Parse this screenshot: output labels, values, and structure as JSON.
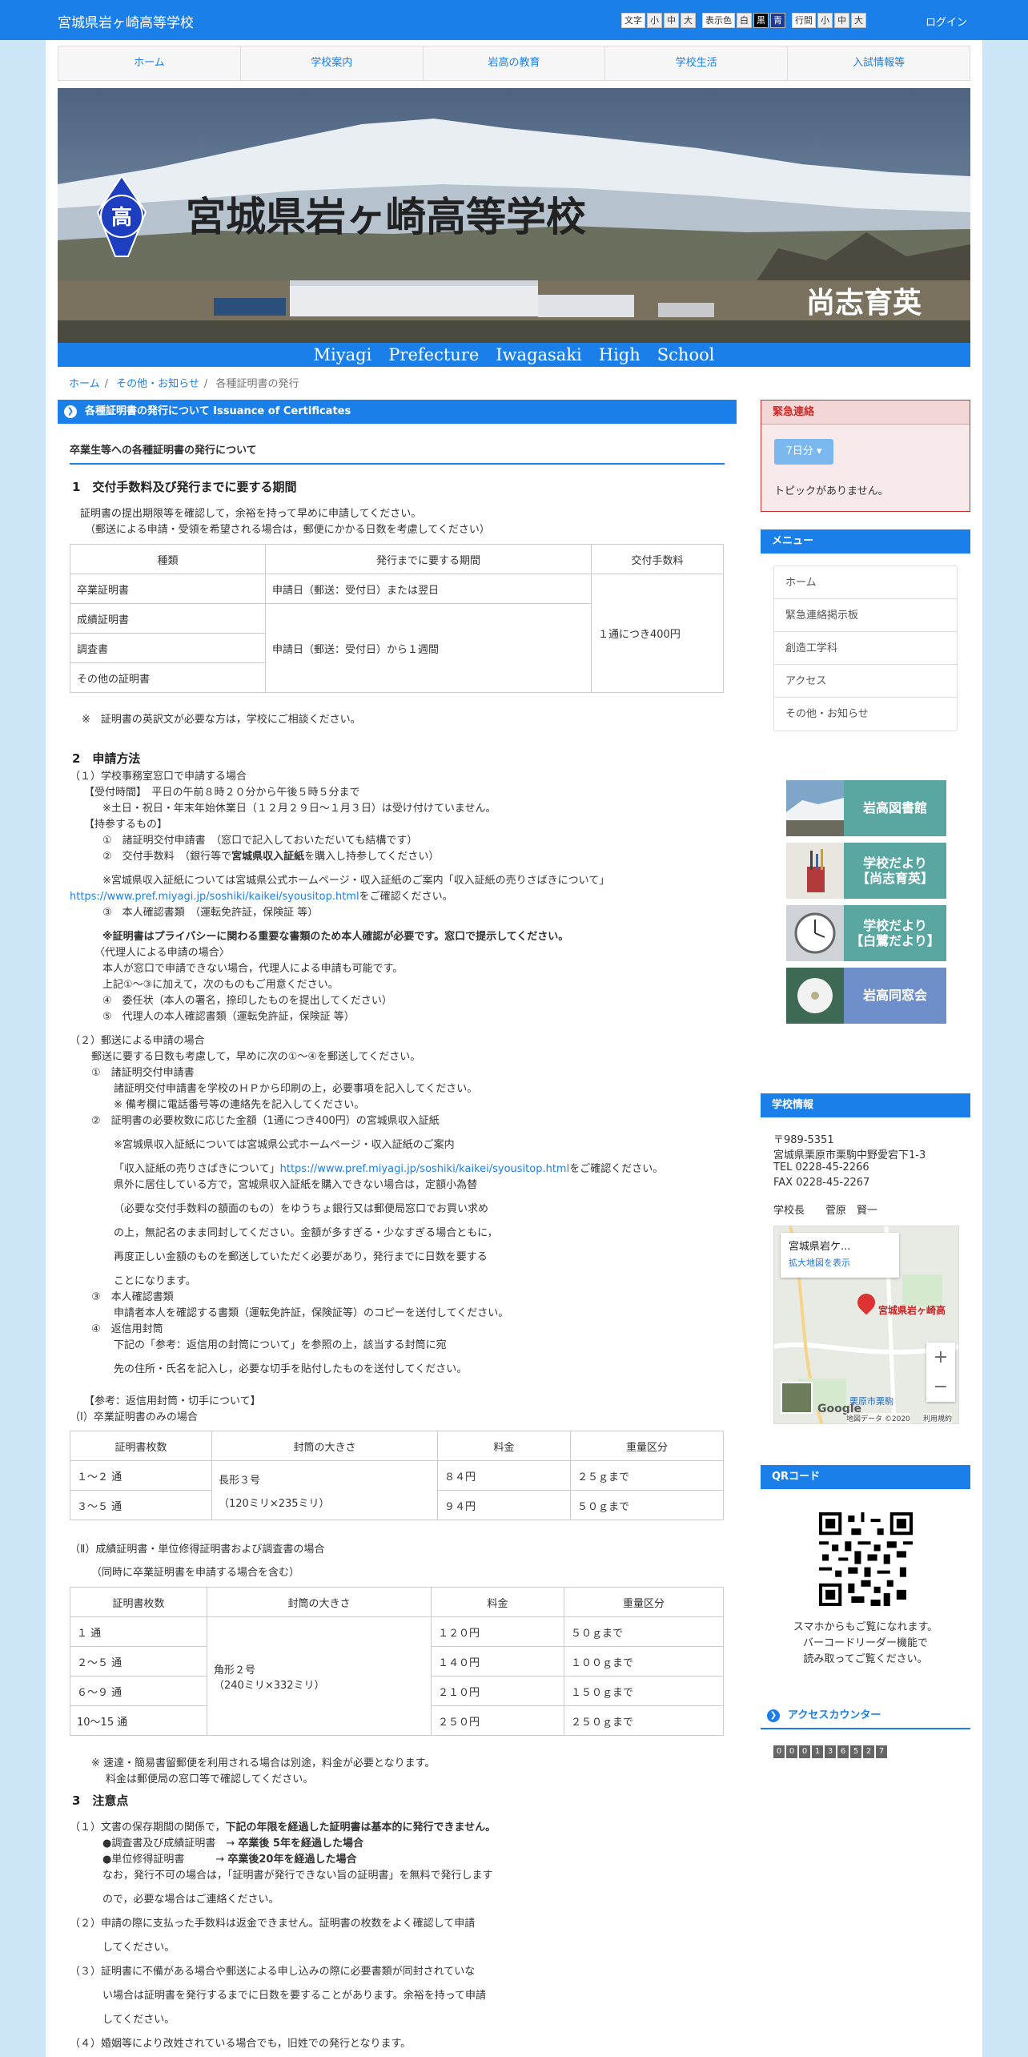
{
  "header": {
    "site_title": "宮城県岩ヶ崎高等学校",
    "login": "ログイン",
    "accessibility": {
      "text_label": "文字",
      "text_sizes": [
        "小",
        "中",
        "大"
      ],
      "color_label": "表示色",
      "colors": [
        "白",
        "黒",
        "青"
      ],
      "line_label": "行間",
      "line_sizes": [
        "小",
        "中",
        "大"
      ]
    }
  },
  "nav": [
    "ホーム",
    "学校案内",
    "岩高の教育",
    "学校生活",
    "入試情報等"
  ],
  "banner": {
    "title": "宮城県岩ヶ崎高等学校",
    "motto": "尚志育英",
    "english": "Miyagi　Prefecture　Iwagasaki　High　School",
    "emblem": "高"
  },
  "breadcrumb": [
    "ホーム",
    "その他・お知らせ",
    "各種証明書の発行"
  ],
  "main": {
    "section_title": "各種証明書の発行について Issuance of Certificates",
    "sub_heading": "卒業生等への各種証明書の発行について",
    "s1": {
      "heading": "1　交付手数料及び発行までに要する期間",
      "lines": [
        "証明書の提出期限等を確認して，余裕を持って早めに申請してください。",
        "（郵送による申請・受領を希望される場合は，郵便にかかる日数を考慮してください）"
      ],
      "table": {
        "headers": [
          "種類",
          "発行までに要する期間",
          "交付手数料"
        ],
        "rows": [
          "卒業証明書",
          "成績証明書",
          "調査書",
          "その他の証明書"
        ],
        "period1": "申請日（郵送：受付日）または翌日",
        "period2": "申請日（郵送：受付日）から１週間",
        "fee": "１通につき400円"
      },
      "note": "※　証明書の英訳文が必要な方は，学校にご相談ください。"
    },
    "s2": {
      "heading": "2　申請方法",
      "lines": [
        "（１）学校事務室窓口で申請する場合",
        "【受付時間】　平日の午前８時２０分から午後５時５分まで",
        "※土日・祝日・年末年始休業日（１２月２９日～１月３日）は受け付けていません。",
        "【持参するもの】",
        "①　諸証明交付申請書　（窓口で記入しておいただいても結構です）",
        "②　交付手数料　（銀行等で",
        "宮城県収入証紙",
        "を購入し持参してください）",
        "※宮城県収入証紙については宮城県公式ホームページ・収入証紙のご案内「収入証紙の売りさばきについて」",
        "https://www.pref.miyagi.jp/soshiki/kaikei/syousitop.html",
        "をご確認ください。",
        "③　本人確認書類　（運転免許証，保険証 等）",
        "※証明書はプライバシーに関わる重要な書類のため本人確認が必要です。窓口で提示してください。",
        "〈代理人による申請の場合〉",
        "本人が窓口で申請できない場合，代理人による申請も可能です。",
        "上記①～③に加えて，次のものもご用意ください。",
        "④　委任状（本人の署名，捺印したものを提出してください）",
        "⑤　代理人の本人確認書類（運転免許証，保険証 等）",
        "（２）郵送による申請の場合",
        "郵送に要する日数も考慮して，早めに次の①～④を郵送してください。",
        "①　諸証明交付申請書",
        "諸証明交付申請書を学校のＨＰから印刷の上，必要事項を記入してください。",
        "※ 備考欄に電話番号等の連絡先を記入してください。",
        "②　証明書の必要枚数に応じた金額（1通につき400円）の宮城県収入証紙",
        "※宮城県収入証紙については宮城県公式ホームページ・収入証紙のご案内",
        "「収入証紙の売りさばきについて」",
        "https://www.pref.miyagi.jp/soshiki/kaikei/syousitop.html",
        "をご確認ください。",
        "県外に居住している方で，宮城県収入証紙を購入できない場合は，定額小為替",
        "（必要な交付手数料の額面のもの）をゆうちょ銀行又は郵便局窓口でお買い求め",
        "の上，無記名のまま同封してください。金額が多すぎる・少なすぎる場合ともに，",
        "再度正しい金額のものを郵送していただく必要があり，発行までに日数を要する",
        "ことになります。",
        "③　本人確認書類",
        "申請者本人を確認する書類（運転免許証，保険証等）のコピーを送付してください。",
        "④　返信用封筒",
        "下記の「参考：返信用の封筒について」を参照の上，該当する封筒に宛",
        "先の住所・氏名を記入し，必要な切手を貼付したものを送付してください。",
        "【参考：返信用封筒・切手について】",
        "（Ⅰ）卒業証明書のみの場合"
      ],
      "table1": {
        "headers": [
          "証明書枚数",
          "封筒の大きさ",
          "料金",
          "重量区分"
        ],
        "rows": [
          [
            "１～２ 通",
            "８４円",
            "２５ｇまで"
          ],
          [
            "３～５ 通",
            "９４円",
            "５０ｇまで"
          ]
        ],
        "envelope": [
          "長形３号",
          "（120ミリ×235ミリ）"
        ]
      },
      "lines2": [
        "（Ⅱ）成績証明書・単位修得証明書および調査書の場合",
        "（同時に卒業証明書を申請する場合を含む）"
      ],
      "table2": {
        "headers": [
          "証明書枚数",
          "封筒の大きさ",
          "料金",
          "重量区分"
        ],
        "rows": [
          [
            "１ 通",
            "１２０円",
            "５０ｇまで"
          ],
          [
            "２～５ 通",
            "１４０円",
            "１００ｇまで"
          ],
          [
            "６～９ 通",
            "２１０円",
            "１５０ｇまで"
          ],
          [
            "10～15 通",
            "２５０円",
            "２５０ｇまで"
          ]
        ],
        "envelope": [
          "角形２号",
          "（240ミリ×332ミリ）"
        ]
      },
      "lines3": [
        "※ 速達・簡易書留郵便を利用される場合は別途，料金が必要となります。",
        "料金は郵便局の窓口等で確認してください。"
      ]
    },
    "s3": {
      "heading": "3　注意点",
      "lines": [
        "（１）文書の保存期間の関係で，",
        "下記の年限を経過した証明書は基本的に発行できません。",
        "●調査書及び成績証明書　→",
        "卒業後 5年を経過した場合",
        "●単位修得証明書　　　→",
        "卒業後20年を経過した場合",
        "なお，発行不可の場合は，「証明書が発行できない旨の証明書」を無料で発行します",
        "ので，必要な場合はご連絡ください。",
        "（２）申請の際に支払った手数料は返金できません。証明書の枚数をよく確認して申請",
        "してください。",
        "（３）証明書に不備がある場合や郵送による申し込みの際に必要書類が同封されていな",
        "い場合は証明書を発行するまでに日数を要することがあります。余裕を持って申請",
        "してください。",
        "（４）婚姻等により改姓されている場合でも，旧姓での発行となります。"
      ]
    }
  },
  "sidebar": {
    "emergency": {
      "title": "緊急連絡",
      "button": "7日分",
      "message": "トピックがありません。"
    },
    "menu": {
      "title": "メニュー",
      "items": [
        "ホーム",
        "緊急連絡掲示板",
        "創造工学科",
        "アクセス",
        "その他・お知らせ"
      ]
    },
    "banners": [
      "岩高図書館",
      "学校だより\n【尚志育英】",
      "学校だより\n【白鷺だより】",
      "岩高同窓会"
    ],
    "school_info": {
      "title": "学校情報",
      "lines": [
        "〒989-5351",
        "宮城県栗原市栗駒中野愛宕下1-3",
        "TEL 0228-45-2266",
        "FAX 0228-45-2267",
        "学校長　　菅原　賢一"
      ],
      "map": {
        "place": "宮城県岩ケ...",
        "larger": "拡大地図を表示",
        "pin_label": "宮城県岩ヶ崎高",
        "brand": "Google",
        "copyright": "地図データ ©2020",
        "terms": "利用規約",
        "town": "栗原市栗駒",
        "zoom_in": "+",
        "zoom_out": "−"
      }
    },
    "qr": {
      "title": "QRコード",
      "lines": [
        "スマホからもご覧になれます。",
        "バーコードリーダー機能で",
        "読み取ってご覧ください。"
      ]
    },
    "counter": {
      "title": "アクセスカウンター",
      "digits": [
        "0",
        "0",
        "0",
        "1",
        "3",
        "6",
        "5",
        "2",
        "7"
      ]
    }
  },
  "colors": {
    "accent": "#1a7fe8",
    "background": "#cce6f7",
    "emergency": "#c9302c"
  }
}
